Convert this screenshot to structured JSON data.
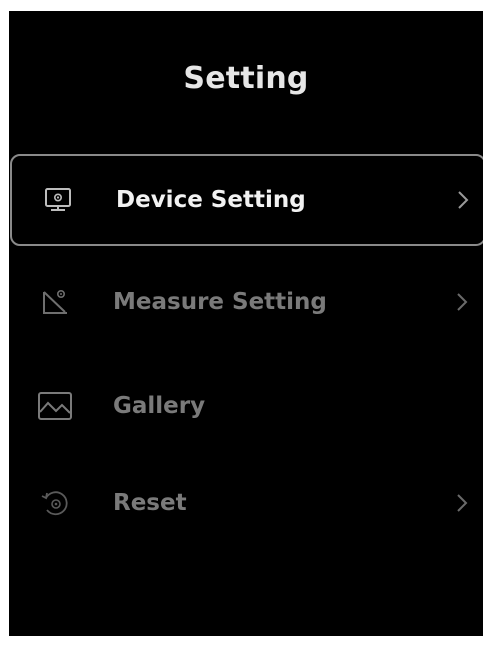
{
  "header": {
    "title": "Setting"
  },
  "menu": {
    "items": [
      {
        "label": "Device Setting",
        "icon": "monitor-settings-icon",
        "has_chevron": true,
        "selected": true
      },
      {
        "label": "Measure Setting",
        "icon": "measure-angle-icon",
        "has_chevron": true,
        "selected": false
      },
      {
        "label": "Gallery",
        "icon": "gallery-image-icon",
        "has_chevron": false,
        "selected": false
      },
      {
        "label": "Reset",
        "icon": "reset-icon",
        "has_chevron": true,
        "selected": false
      }
    ]
  },
  "colors": {
    "background": "#000000",
    "selected_border": "#8a8a8a",
    "selected_text": "#f2f2f2",
    "normal_text": "#7a7a7a"
  }
}
